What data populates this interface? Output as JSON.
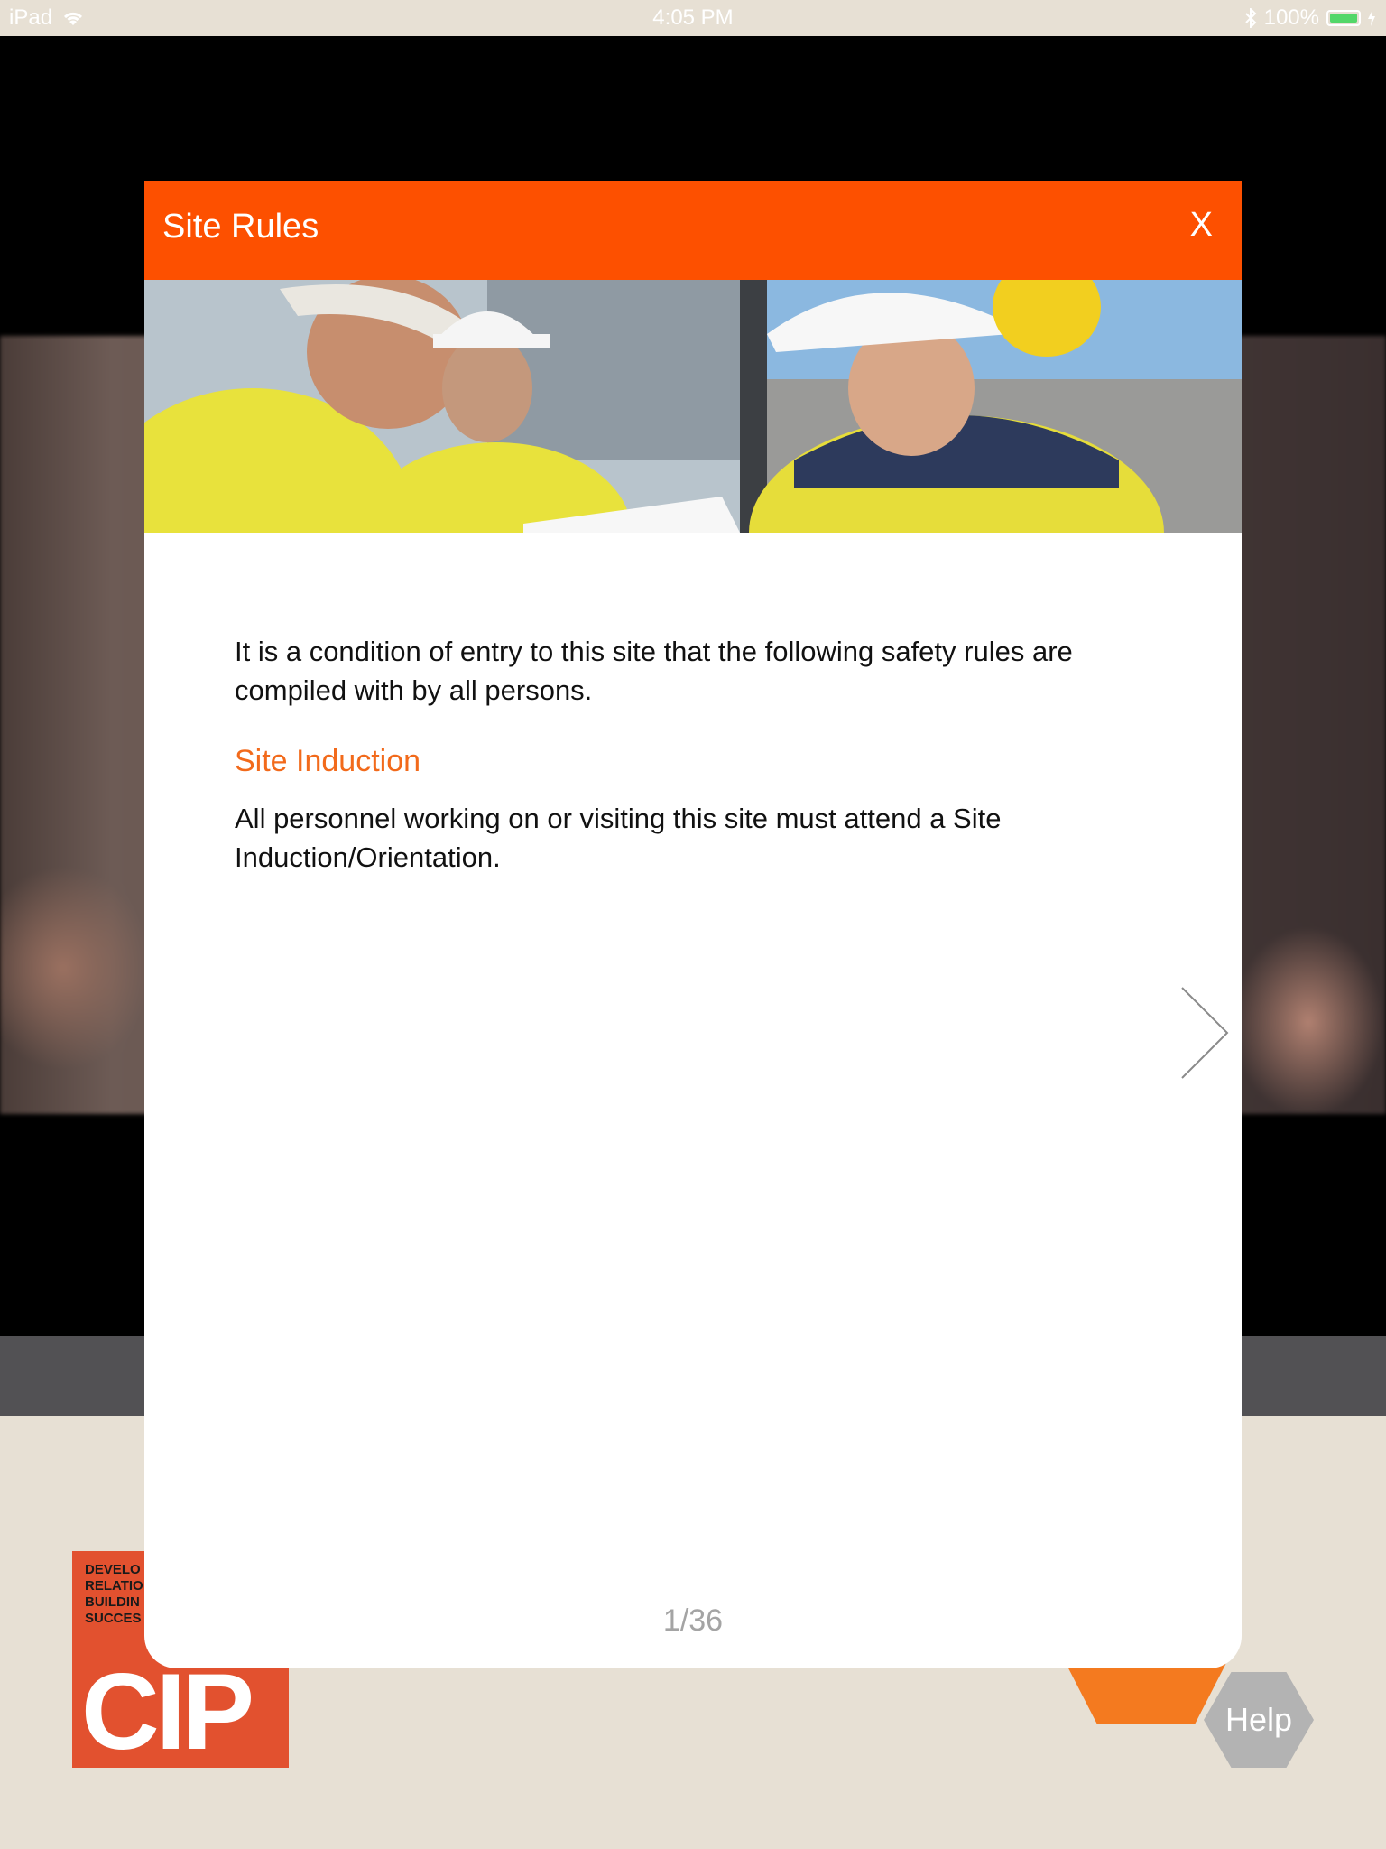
{
  "status_bar": {
    "device": "iPad",
    "time": "4:05 PM",
    "battery": "100%"
  },
  "background": {
    "logo": {
      "tagline": [
        "DEVELO",
        "RELATIO",
        "BUILDIN",
        "SUCCES"
      ],
      "wordmark": "CIP"
    },
    "help_label": "Help"
  },
  "modal": {
    "title": "Site Rules",
    "close_label": "X",
    "intro": "It is a condition of entry to this site that the following safety rules are compiled with by all persons.",
    "section_title": "Site Induction",
    "section_body": "All personnel working on or visiting this site must attend a Site Induction/Orientation.",
    "pager": "1/36"
  },
  "colors": {
    "header": "#fd5000",
    "accent_text": "#f26a1b",
    "logo_bg": "#e2512f",
    "help_bg": "#b3b3b3"
  },
  "icons": {
    "wifi": "wifi-icon",
    "bluetooth": "bluetooth-icon",
    "battery": "battery-icon",
    "next": "chevron-right-icon"
  }
}
